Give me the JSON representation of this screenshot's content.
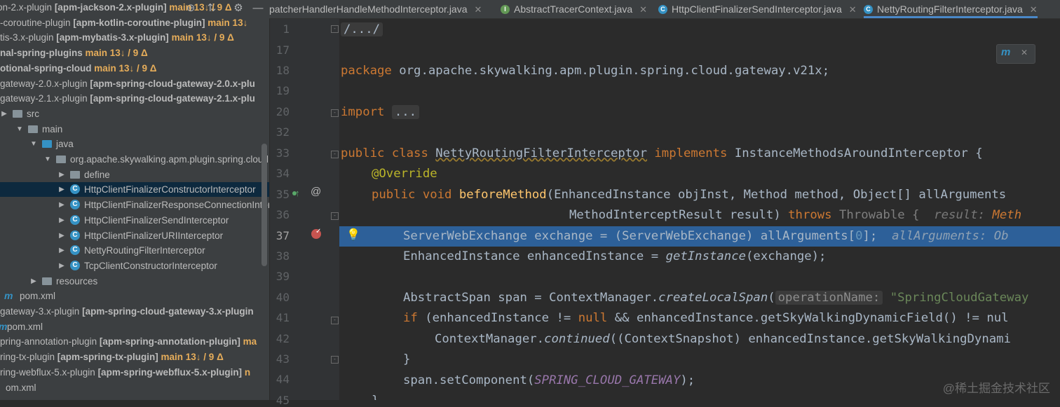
{
  "tree": {
    "toolbar": {
      "locate_icon": "crosshair-icon",
      "collapse_icon": "collapse-icon",
      "settings_icon": "gear-icon",
      "hide_icon": "minus-icon"
    },
    "rows": [
      {
        "indent": 0,
        "prefix": "on-2.x-plugin",
        "module": "[apm-jackson-2.x-plugin]",
        "branch": "main 13↓ / 9 Δ"
      },
      {
        "indent": 0,
        "prefix": "-coroutine-plugin",
        "module": "[apm-kotlin-coroutine-plugin]",
        "branch": "main 13↓"
      },
      {
        "indent": 0,
        "prefix": "tis-3.x-plugin",
        "module": "[apm-mybatis-3.x-plugin]",
        "branch": "main 13↓ / 9 Δ"
      },
      {
        "indent": 0,
        "prefix": "",
        "module": "nal-spring-plugins",
        "branch": "main 13↓ / 9 Δ"
      },
      {
        "indent": 0,
        "prefix": "",
        "module": "otional-spring-cloud",
        "branch": "main 13↓ / 9 Δ"
      },
      {
        "indent": 0,
        "prefix": "gateway-2.0.x-plugin",
        "module": "[apm-spring-cloud-gateway-2.0.x-plu",
        "branch": ""
      },
      {
        "indent": 0,
        "prefix": "gateway-2.1.x-plugin",
        "module": "[apm-spring-cloud-gateway-2.1.x-plu",
        "branch": ""
      },
      {
        "indent": 0,
        "label": "src",
        "kind": "folder"
      },
      {
        "indent": 1,
        "label": "main",
        "kind": "folder",
        "open": true
      },
      {
        "indent": 2,
        "label": "java",
        "kind": "folder",
        "open": true
      },
      {
        "indent": 3,
        "label": "org.apache.skywalking.apm.plugin.spring.cloud",
        "kind": "pkg",
        "open": true
      },
      {
        "indent": 4,
        "label": "define",
        "kind": "pkg"
      },
      {
        "indent": 4,
        "label": "HttpClientFinalizerConstructorInterceptor",
        "kind": "class",
        "selected": true
      },
      {
        "indent": 4,
        "label": "HttpClientFinalizerResponseConnectionInter",
        "kind": "class"
      },
      {
        "indent": 4,
        "label": "HttpClientFinalizerSendInterceptor",
        "kind": "class"
      },
      {
        "indent": 4,
        "label": "HttpClientFinalizerURIInterceptor",
        "kind": "class"
      },
      {
        "indent": 4,
        "label": "NettyRoutingFilterInterceptor",
        "kind": "class"
      },
      {
        "indent": 4,
        "label": "TcpClientConstructorInterceptor",
        "kind": "class"
      },
      {
        "indent": 2,
        "label": "resources",
        "kind": "folder"
      },
      {
        "indent": 0,
        "label": "pom.xml",
        "kind": "maven"
      },
      {
        "indent": 0,
        "prefix": "gateway-3.x-plugin",
        "module": "[apm-spring-cloud-gateway-3.x-plugin",
        "branch": ""
      },
      {
        "indent": 0,
        "label": "pom.xml",
        "kind": "maven2"
      },
      {
        "indent": 0,
        "prefix": "pring-annotation-plugin",
        "module": "[apm-spring-annotation-plugin]",
        "branch": "ma"
      },
      {
        "indent": 0,
        "prefix": "ring-tx-plugin",
        "module": "[apm-spring-tx-plugin]",
        "branch": "main 13↓ / 9 Δ"
      },
      {
        "indent": 0,
        "prefix": "ring-webflux-5.x-plugin",
        "module": "[apm-spring-webflux-5.x-plugin]",
        "branch": "n"
      },
      {
        "indent": 0,
        "label": "om.xml",
        "kind": "plain"
      }
    ]
  },
  "tabs": [
    {
      "label": "patcherHandlerHandleMethodInterceptor.java",
      "icon": "",
      "color": ""
    },
    {
      "label": "AbstractTracerContext.java",
      "icon": "I",
      "color": "#629755"
    },
    {
      "label": "HttpClientFinalizerSendInterceptor.java",
      "icon": "C",
      "color": "#3592c4"
    },
    {
      "label": "NettyRoutingFilterInterceptor.java",
      "icon": "C",
      "color": "#3592c4",
      "active": true
    }
  ],
  "tab_close": "✕",
  "gutter": {
    "lines": [
      "1",
      "17",
      "18",
      "19",
      "20",
      "32",
      "33",
      "34",
      "35",
      "36",
      "37",
      "38",
      "39",
      "40",
      "41",
      "42",
      "43",
      "44",
      "45"
    ],
    "current": "37"
  },
  "code": {
    "l1_fold": "/.../",
    "package_kw": "package",
    "package_name": " org.apache.skywalking.apm.plugin.spring.cloud.gateway.v21x;",
    "import_kw": "import",
    "import_fold": "...",
    "class_decl": {
      "kw1": "public class ",
      "name": "NettyRoutingFilterInterceptor",
      "kw2": " implements ",
      "iface": "InstanceMethodsAroundInterceptor {"
    },
    "override": "@Override",
    "method": {
      "kw": "public void ",
      "name": "beforeMethod",
      "rest": "(EnhancedInstance objInst, Method method, Object[] allArguments"
    },
    "method2": {
      "text": "MethodInterceptResult result) ",
      "kw": "throws ",
      "thr": "Throwable {  ",
      "hint_label": "result: ",
      "hint_val": "Meth"
    },
    "l37": {
      "text": "ServerWebExchange exchange = (ServerWebExchange) allArguments[",
      "num": "0",
      "end": "];  ",
      "hint": "allArguments: Ob"
    },
    "l38": {
      "text": "EnhancedInstance enhancedInstance = ",
      "fn": "getInstance",
      "end": "(exchange);"
    },
    "l40": {
      "text": "AbstractSpan span = ContextManager.",
      "fn": "createLocalSpan",
      "paren": "(",
      "hint": "operationName:",
      "str": " \"SpringCloudGateway"
    },
    "l41": {
      "kw": "if ",
      "a": "(enhancedInstance != ",
      "null": "null",
      "b": " && enhancedInstance.getSkyWalkingDynamicField() != nul"
    },
    "l42": {
      "text": "ContextManager.",
      "fn": "continued",
      "end": "((ContextSnapshot) enhancedInstance.getSkyWalkingDynami"
    },
    "l43": "}",
    "l44": {
      "text": "span.setComponent(",
      "const": "SPRING_CLOUD_GATEWAY",
      "end": ");"
    },
    "l45": "}"
  },
  "watermark": "@稀土掘金技术社区",
  "popup": {
    "icon": "maven-icon",
    "close": "✕"
  }
}
